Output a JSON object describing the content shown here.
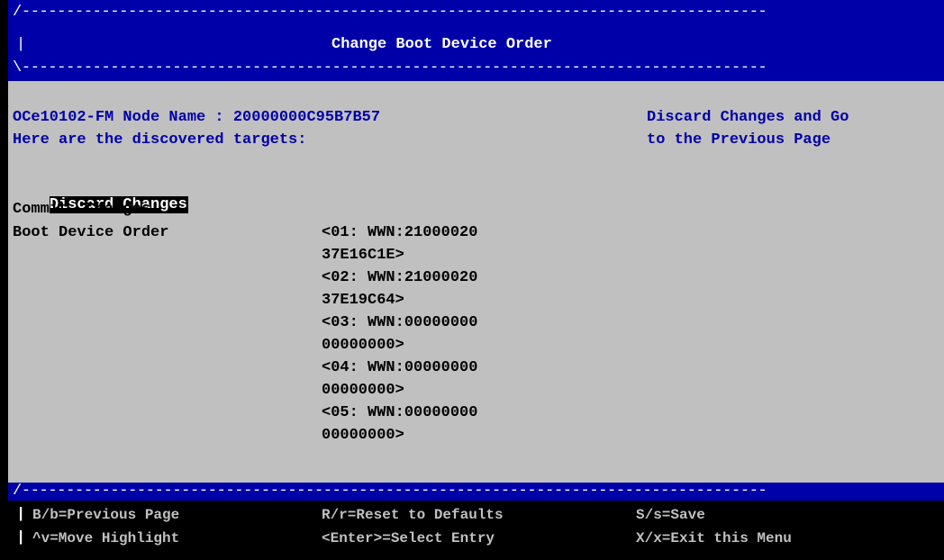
{
  "header": {
    "top_border": "/------------------------------------------------------------------------------------",
    "title_bar": "|",
    "title": "Change Boot Device Order",
    "bottom_border": "\\------------------------------------------------------------------------------------"
  },
  "info": {
    "node_line": "OCe10102-FM Node Name : 20000000C95B7B57",
    "targets_line": "Here are the discovered targets:"
  },
  "help": {
    "line1": "Discard Changes and Go",
    "line2": "to the Previous Page"
  },
  "menu": {
    "discard": "Discard Changes",
    "commit": "Commit  Changes",
    "boot_order": "Boot Device Order"
  },
  "devices": [
    {
      "line1": "<01: WWN:21000020",
      "line2": "37E16C1E>"
    },
    {
      "line1": "<02: WWN:21000020",
      "line2": "37E19C64>"
    },
    {
      "line1": "<03: WWN:00000000",
      "line2": "00000000>"
    },
    {
      "line1": "<04: WWN:00000000",
      "line2": "00000000>"
    },
    {
      "line1": "<05: WWN:00000000",
      "line2": "00000000>"
    }
  ],
  "footer": {
    "top_border": "/------------------------------------------------------------------------------------",
    "bar": "|",
    "row1": {
      "col1": "B/b=Previous Page",
      "col2": "R/r=Reset to Defaults",
      "col3": "S/s=Save"
    },
    "row2": {
      "col1": "^v=Move Highlight",
      "col2": "<Enter>=Select Entry",
      "col3": "X/x=Exit this Menu"
    }
  }
}
